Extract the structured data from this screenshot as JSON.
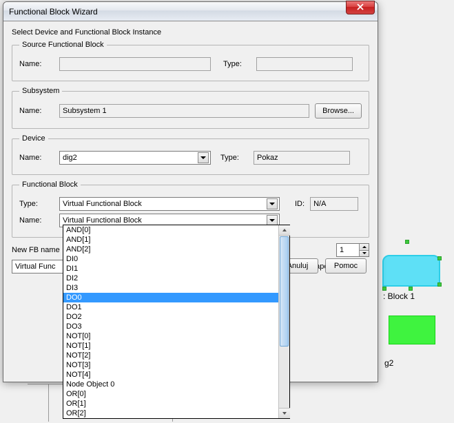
{
  "window": {
    "title": "Functional Block Wizard"
  },
  "instruction": "Select Device and Functional Block Instance",
  "source_fb": {
    "legend": "Source Functional Block",
    "name_label": "Name:",
    "name_value": "",
    "type_label": "Type:",
    "type_value": ""
  },
  "subsystem": {
    "legend": "Subsystem",
    "name_label": "Name:",
    "name_value": "Subsystem 1",
    "browse_label": "Browse..."
  },
  "device": {
    "legend": "Device",
    "name_label": "Name:",
    "name_value": "dig2",
    "type_label": "Type:",
    "type_value": "Pokaz"
  },
  "fb": {
    "legend": "Functional Block",
    "type_label": "Type:",
    "type_value": "Virtual Functional Block",
    "id_label": "ID:",
    "id_value": "N/A",
    "name_label": "Name:",
    "name_value": "Virtual Functional Block",
    "options": [
      "AND[0]",
      "AND[1]",
      "AND[2]",
      "DI0",
      "DI1",
      "DI2",
      "DI3",
      "DO0",
      "DO1",
      "DO2",
      "DO3",
      "NOT[0]",
      "NOT[1]",
      "NOT[2]",
      "NOT[3]",
      "NOT[4]",
      "Node Object 0",
      "OR[0]",
      "OR[1]",
      "OR[2]"
    ],
    "selected_index": 7
  },
  "new_fb": {
    "label": "New FB name",
    "value": "Virtual Func",
    "count": "1",
    "shapes_text": "s shapes"
  },
  "buttons": {
    "cancel": "Anuluj",
    "help": "Pomoc"
  },
  "bg": {
    "label1": ": Block 1",
    "label2": "g2"
  }
}
